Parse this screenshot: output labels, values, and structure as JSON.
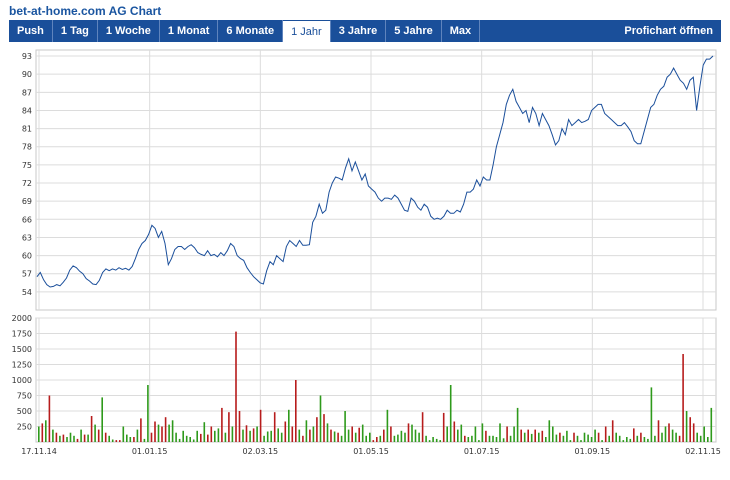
{
  "page": {
    "title": "bet-at-home.com AG Chart"
  },
  "tabs": [
    {
      "label": "Push",
      "active": false
    },
    {
      "label": "1 Tag",
      "active": false
    },
    {
      "label": "1 Woche",
      "active": false
    },
    {
      "label": "1 Monat",
      "active": false
    },
    {
      "label": "6 Monate",
      "active": false
    },
    {
      "label": "1 Jahr",
      "active": true
    },
    {
      "label": "3 Jahre",
      "active": false
    },
    {
      "label": "5 Jahre",
      "active": false
    },
    {
      "label": "Max",
      "active": false
    }
  ],
  "profichart_label": "Profichart öffnen",
  "colors": {
    "tab_bar": "#1a4f9a",
    "price_line": "#1b4f9b",
    "volume_up": "#2e9a1b",
    "volume_down": "#b71c1c",
    "grid": "#dcdcdc"
  },
  "chart_data": {
    "type": "line",
    "x_ticks": [
      "17.11.14",
      "01.01.15",
      "02.03.15",
      "01.05.15",
      "01.07.15",
      "01.09.15",
      "02.11.15"
    ],
    "price": {
      "ylim": [
        51,
        94
      ],
      "yticks": [
        54,
        57,
        60,
        63,
        66,
        69,
        72,
        75,
        78,
        81,
        84,
        87,
        90,
        93
      ],
      "series": [
        {
          "name": "",
          "values": [
            56.5,
            57.2,
            56.0,
            55.2,
            54.8,
            54.9,
            55.2,
            55.0,
            55.6,
            56.3,
            57.6,
            58.3,
            58.0,
            57.4,
            57.0,
            56.2,
            55.8,
            55.3,
            55.2,
            55.9,
            57.2,
            57.8,
            57.5,
            57.8,
            57.6,
            58.0,
            57.7,
            57.9,
            57.6,
            58.2,
            59.5,
            61.0,
            62.0,
            62.5,
            63.5,
            65.0,
            64.5,
            63.0,
            64.0,
            62.0,
            58.5,
            59.5,
            61.0,
            61.5,
            61.5,
            61.0,
            61.5,
            61.8,
            61.3,
            60.5,
            60.2,
            60.0,
            60.8,
            60.0,
            60.2,
            59.8,
            60.5,
            60.0,
            60.8,
            62.0,
            61.5,
            60.0,
            59.5,
            59.2,
            58.0,
            57.2,
            56.5,
            56.0,
            55.5,
            55.3,
            57.5,
            59.0,
            58.5,
            60.0,
            59.5,
            59.0,
            61.5,
            62.5,
            62.0,
            61.5,
            62.5,
            61.7,
            61.7,
            61.8,
            65.5,
            66.5,
            68.5,
            67.0,
            67.5,
            70.5,
            72.0,
            73.0,
            72.8,
            72.5,
            74.5,
            76.0,
            74.0,
            75.5,
            74.0,
            72.5,
            73.5,
            71.5,
            71.0,
            70.5,
            69.5,
            69.0,
            69.5,
            69.5,
            69.3,
            70.0,
            69.5,
            68.5,
            67.5,
            67.3,
            69.5,
            69.0,
            68.0,
            67.5,
            68.5,
            68.0,
            66.5,
            66.0,
            66.2,
            66.0,
            66.5,
            67.5,
            67.0,
            67.0,
            67.5,
            67.2,
            68.5,
            70.5,
            70.5,
            71.0,
            72.5,
            71.5,
            73.0,
            72.5,
            72.5,
            75.0,
            78.0,
            80.0,
            82.0,
            85.0,
            86.5,
            87.5,
            85.5,
            84.5,
            83.5,
            84.0,
            82.0,
            84.5,
            83.5,
            81.5,
            83.5,
            82.5,
            81.5,
            80.0,
            78.3,
            79.0,
            81.0,
            80.0,
            82.5,
            81.5,
            82.0,
            82.5,
            82.0,
            82.2,
            82.5,
            84.0,
            84.5,
            85.0,
            85.0,
            83.5,
            83.0,
            82.5,
            82.0,
            81.5,
            81.5,
            82.0,
            81.3,
            80.5,
            79.0,
            78.5,
            78.5,
            80.5,
            82.5,
            84.5,
            85.0,
            86.5,
            87.5,
            88.0,
            89.5,
            90.0,
            91.0,
            90.0,
            89.0,
            88.5,
            87.5,
            89.0,
            89.5,
            84.0,
            88.0,
            91.5,
            92.5,
            92.5,
            93.0
          ]
        }
      ]
    },
    "volume": {
      "ylim": [
        0,
        2000
      ],
      "yticks": [
        250,
        500,
        750,
        1000,
        1250,
        1500,
        1750,
        2000
      ],
      "bars": [
        {
          "v": 250,
          "d": "up"
        },
        {
          "v": 300,
          "d": "down"
        },
        {
          "v": 350,
          "d": "up"
        },
        {
          "v": 750,
          "d": "down"
        },
        {
          "v": 200,
          "d": "up"
        },
        {
          "v": 150,
          "d": "down"
        },
        {
          "v": 100,
          "d": "up"
        },
        {
          "v": 120,
          "d": "down"
        },
        {
          "v": 80,
          "d": "up"
        },
        {
          "v": 150,
          "d": "up"
        },
        {
          "v": 100,
          "d": "up"
        },
        {
          "v": 50,
          "d": "down"
        },
        {
          "v": 200,
          "d": "up"
        },
        {
          "v": 120,
          "d": "down"
        },
        {
          "v": 120,
          "d": "up"
        },
        {
          "v": 420,
          "d": "down"
        },
        {
          "v": 280,
          "d": "up"
        },
        {
          "v": 200,
          "d": "down"
        },
        {
          "v": 720,
          "d": "up"
        },
        {
          "v": 150,
          "d": "down"
        },
        {
          "v": 100,
          "d": "up"
        },
        {
          "v": 40,
          "d": "up"
        },
        {
          "v": 30,
          "d": "down"
        },
        {
          "v": 30,
          "d": "down"
        },
        {
          "v": 250,
          "d": "up"
        },
        {
          "v": 120,
          "d": "up"
        },
        {
          "v": 80,
          "d": "up"
        },
        {
          "v": 80,
          "d": "down"
        },
        {
          "v": 200,
          "d": "up"
        },
        {
          "v": 380,
          "d": "down"
        },
        {
          "v": 50,
          "d": "up"
        },
        {
          "v": 920,
          "d": "up"
        },
        {
          "v": 150,
          "d": "down"
        },
        {
          "v": 330,
          "d": "down"
        },
        {
          "v": 280,
          "d": "up"
        },
        {
          "v": 250,
          "d": "down"
        },
        {
          "v": 400,
          "d": "down"
        },
        {
          "v": 280,
          "d": "up"
        },
        {
          "v": 350,
          "d": "up"
        },
        {
          "v": 150,
          "d": "up"
        },
        {
          "v": 50,
          "d": "up"
        },
        {
          "v": 180,
          "d": "up"
        },
        {
          "v": 100,
          "d": "up"
        },
        {
          "v": 80,
          "d": "up"
        },
        {
          "v": 40,
          "d": "up"
        },
        {
          "v": 180,
          "d": "up"
        },
        {
          "v": 130,
          "d": "down"
        },
        {
          "v": 320,
          "d": "up"
        },
        {
          "v": 120,
          "d": "down"
        },
        {
          "v": 250,
          "d": "down"
        },
        {
          "v": 180,
          "d": "up"
        },
        {
          "v": 220,
          "d": "up"
        },
        {
          "v": 550,
          "d": "down"
        },
        {
          "v": 150,
          "d": "up"
        },
        {
          "v": 480,
          "d": "down"
        },
        {
          "v": 250,
          "d": "up"
        },
        {
          "v": 1780,
          "d": "down"
        },
        {
          "v": 500,
          "d": "down"
        },
        {
          "v": 200,
          "d": "up"
        },
        {
          "v": 270,
          "d": "down"
        },
        {
          "v": 180,
          "d": "up"
        },
        {
          "v": 220,
          "d": "down"
        },
        {
          "v": 250,
          "d": "up"
        },
        {
          "v": 520,
          "d": "down"
        },
        {
          "v": 100,
          "d": "up"
        },
        {
          "v": 170,
          "d": "up"
        },
        {
          "v": 180,
          "d": "up"
        },
        {
          "v": 480,
          "d": "down"
        },
        {
          "v": 220,
          "d": "up"
        },
        {
          "v": 150,
          "d": "up"
        },
        {
          "v": 330,
          "d": "down"
        },
        {
          "v": 520,
          "d": "up"
        },
        {
          "v": 250,
          "d": "down"
        },
        {
          "v": 1000,
          "d": "down"
        },
        {
          "v": 200,
          "d": "up"
        },
        {
          "v": 100,
          "d": "down"
        },
        {
          "v": 350,
          "d": "up"
        },
        {
          "v": 200,
          "d": "down"
        },
        {
          "v": 250,
          "d": "up"
        },
        {
          "v": 400,
          "d": "down"
        },
        {
          "v": 750,
          "d": "up"
        },
        {
          "v": 450,
          "d": "down"
        },
        {
          "v": 300,
          "d": "up"
        },
        {
          "v": 200,
          "d": "down"
        },
        {
          "v": 170,
          "d": "up"
        },
        {
          "v": 150,
          "d": "down"
        },
        {
          "v": 100,
          "d": "up"
        },
        {
          "v": 500,
          "d": "up"
        },
        {
          "v": 200,
          "d": "up"
        },
        {
          "v": 250,
          "d": "down"
        },
        {
          "v": 150,
          "d": "up"
        },
        {
          "v": 230,
          "d": "down"
        },
        {
          "v": 280,
          "d": "up"
        },
        {
          "v": 100,
          "d": "up"
        },
        {
          "v": 150,
          "d": "up"
        },
        {
          "v": 30,
          "d": "down"
        },
        {
          "v": 80,
          "d": "down"
        },
        {
          "v": 100,
          "d": "up"
        },
        {
          "v": 200,
          "d": "down"
        },
        {
          "v": 520,
          "d": "up"
        },
        {
          "v": 250,
          "d": "down"
        },
        {
          "v": 100,
          "d": "up"
        },
        {
          "v": 120,
          "d": "up"
        },
        {
          "v": 180,
          "d": "up"
        },
        {
          "v": 150,
          "d": "up"
        },
        {
          "v": 300,
          "d": "down"
        },
        {
          "v": 280,
          "d": "up"
        },
        {
          "v": 200,
          "d": "up"
        },
        {
          "v": 150,
          "d": "up"
        },
        {
          "v": 480,
          "d": "down"
        },
        {
          "v": 100,
          "d": "up"
        },
        {
          "v": 30,
          "d": "up"
        },
        {
          "v": 80,
          "d": "up"
        },
        {
          "v": 50,
          "d": "up"
        },
        {
          "v": 30,
          "d": "up"
        },
        {
          "v": 470,
          "d": "down"
        },
        {
          "v": 250,
          "d": "up"
        },
        {
          "v": 920,
          "d": "up"
        },
        {
          "v": 330,
          "d": "down"
        },
        {
          "v": 200,
          "d": "up"
        },
        {
          "v": 280,
          "d": "up"
        },
        {
          "v": 100,
          "d": "down"
        },
        {
          "v": 80,
          "d": "up"
        },
        {
          "v": 100,
          "d": "up"
        },
        {
          "v": 250,
          "d": "up"
        },
        {
          "v": 30,
          "d": "up"
        },
        {
          "v": 300,
          "d": "up"
        },
        {
          "v": 180,
          "d": "down"
        },
        {
          "v": 100,
          "d": "up"
        },
        {
          "v": 100,
          "d": "up"
        },
        {
          "v": 80,
          "d": "up"
        },
        {
          "v": 300,
          "d": "up"
        },
        {
          "v": 60,
          "d": "up"
        },
        {
          "v": 250,
          "d": "down"
        },
        {
          "v": 100,
          "d": "up"
        },
        {
          "v": 250,
          "d": "up"
        },
        {
          "v": 550,
          "d": "up"
        },
        {
          "v": 200,
          "d": "down"
        },
        {
          "v": 150,
          "d": "up"
        },
        {
          "v": 200,
          "d": "down"
        },
        {
          "v": 130,
          "d": "up"
        },
        {
          "v": 200,
          "d": "down"
        },
        {
          "v": 150,
          "d": "up"
        },
        {
          "v": 180,
          "d": "down"
        },
        {
          "v": 80,
          "d": "up"
        },
        {
          "v": 350,
          "d": "up"
        },
        {
          "v": 250,
          "d": "up"
        },
        {
          "v": 120,
          "d": "up"
        },
        {
          "v": 150,
          "d": "down"
        },
        {
          "v": 100,
          "d": "up"
        },
        {
          "v": 180,
          "d": "up"
        },
        {
          "v": 30,
          "d": "up"
        },
        {
          "v": 150,
          "d": "down"
        },
        {
          "v": 100,
          "d": "up"
        },
        {
          "v": 30,
          "d": "up"
        },
        {
          "v": 150,
          "d": "up"
        },
        {
          "v": 120,
          "d": "up"
        },
        {
          "v": 80,
          "d": "up"
        },
        {
          "v": 200,
          "d": "up"
        },
        {
          "v": 150,
          "d": "down"
        },
        {
          "v": 30,
          "d": "up"
        },
        {
          "v": 250,
          "d": "down"
        },
        {
          "v": 100,
          "d": "up"
        },
        {
          "v": 350,
          "d": "down"
        },
        {
          "v": 150,
          "d": "up"
        },
        {
          "v": 100,
          "d": "up"
        },
        {
          "v": 30,
          "d": "up"
        },
        {
          "v": 80,
          "d": "up"
        },
        {
          "v": 50,
          "d": "up"
        },
        {
          "v": 220,
          "d": "down"
        },
        {
          "v": 100,
          "d": "up"
        },
        {
          "v": 150,
          "d": "down"
        },
        {
          "v": 80,
          "d": "up"
        },
        {
          "v": 50,
          "d": "up"
        },
        {
          "v": 880,
          "d": "up"
        },
        {
          "v": 100,
          "d": "up"
        },
        {
          "v": 350,
          "d": "down"
        },
        {
          "v": 150,
          "d": "up"
        },
        {
          "v": 250,
          "d": "up"
        },
        {
          "v": 300,
          "d": "down"
        },
        {
          "v": 200,
          "d": "up"
        },
        {
          "v": 150,
          "d": "up"
        },
        {
          "v": 100,
          "d": "down"
        },
        {
          "v": 1420,
          "d": "down"
        },
        {
          "v": 500,
          "d": "up"
        },
        {
          "v": 400,
          "d": "down"
        },
        {
          "v": 300,
          "d": "down"
        },
        {
          "v": 150,
          "d": "up"
        },
        {
          "v": 100,
          "d": "up"
        },
        {
          "v": 250,
          "d": "up"
        },
        {
          "v": 80,
          "d": "up"
        },
        {
          "v": 550,
          "d": "up"
        }
      ]
    }
  }
}
